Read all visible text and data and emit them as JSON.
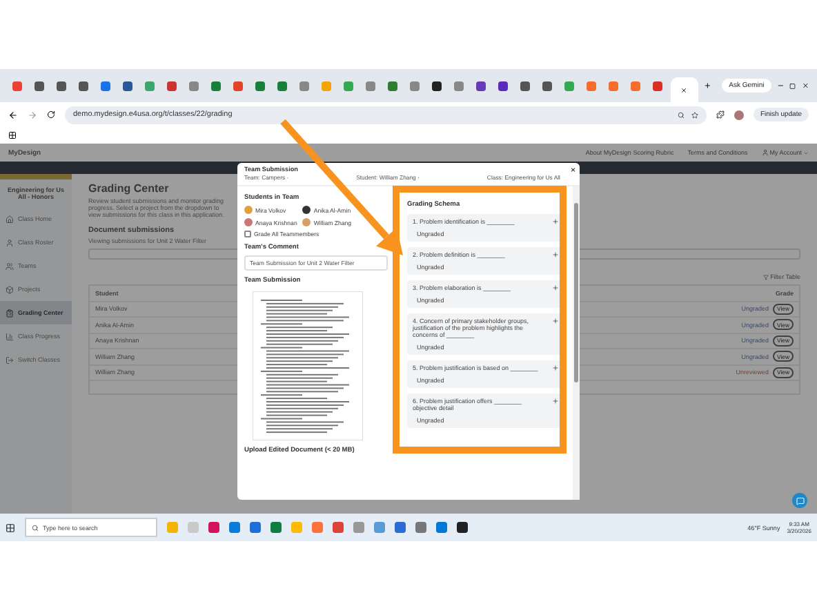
{
  "browser": {
    "ask_button": "Ask Gemini",
    "url": "demo.mydesign.e4usa.org/t/classes/22/grading",
    "update_button": "Finish update"
  },
  "header": {
    "logo": "MyDesign",
    "links": [
      "About MyDesign Scoring Rubric",
      "Terms and Conditions"
    ],
    "account": "My Account"
  },
  "sidebar": {
    "class_name": "Engineering for Us All - Honors",
    "items": [
      {
        "label": "Class Home",
        "selected": false
      },
      {
        "label": "Class Roster",
        "selected": false
      },
      {
        "label": "Teams",
        "selected": false
      },
      {
        "label": "Projects",
        "selected": false
      },
      {
        "label": "Grading Center",
        "selected": true
      },
      {
        "label": "Class Progress",
        "selected": false
      },
      {
        "label": "Switch Classes",
        "selected": false
      }
    ]
  },
  "main": {
    "title": "Grading Center",
    "description": "Review student submissions and monitor grading progress. Select a project from the dropdown to view submissions for this class in this application.",
    "section_title": "Document submissions",
    "section_subtitle": "Viewing submissions for Unit 2 Water Filter",
    "filter_button": "Filter Table",
    "table": {
      "columns": [
        "Student",
        "Grade"
      ],
      "rows": [
        {
          "student": "Mira Volkov",
          "grade": "Ungraded",
          "kind": "ungraded",
          "action": "View"
        },
        {
          "student": "Anika Al-Amin",
          "grade": "Ungraded",
          "kind": "ungraded",
          "action": "View"
        },
        {
          "student": "Anaya Krishnan",
          "grade": "Ungraded",
          "kind": "ungraded",
          "action": "View"
        },
        {
          "student": "William Zhang",
          "grade": "Ungraded",
          "kind": "ungraded",
          "action": "View"
        },
        {
          "student": "William Zhang",
          "grade": "Unreviewed",
          "kind": "unreviewed",
          "action": "View"
        }
      ]
    }
  },
  "modal": {
    "title": "Team Submission",
    "subtitle_parts": [
      "Team: Campers ·",
      "Student: William Zhang ·",
      "Class: Engineering for Us All"
    ],
    "close": "×",
    "students_title": "Students in Team",
    "students": [
      "Mira Volkov",
      "Anika Al-Amin",
      "Anaya Krishnan",
      "William Zhang"
    ],
    "grade_all": {
      "label": "Grade All Teammembers",
      "checked": false
    },
    "comment_title": "Team's Comment",
    "comment": "Team Submission for Unit 2 Water Filter",
    "submission_title": "Team Submission",
    "upload_label": "Upload Edited Document (< 20 MB)",
    "schema_title": "Grading Schema",
    "schema": [
      {
        "criterion": "1. Problem identification is ________",
        "status": "Ungraded"
      },
      {
        "criterion": "2. Problem definition is ________",
        "status": "Ungraded"
      },
      {
        "criterion": "3. Problem elaboration is ________",
        "status": "Ungraded"
      },
      {
        "criterion": "4. Concern of primary stakeholder groups, justification of the problem highlights the concerns of ________",
        "status": "Ungraded"
      },
      {
        "criterion": "5. Problem justification is based on ________",
        "status": "Ungraded"
      },
      {
        "criterion": "6. Problem justification offers ________ objective detail",
        "status": "Ungraded"
      }
    ]
  },
  "taskbar": {
    "search_placeholder": "Type here to search",
    "weather": "46°F  Sunny",
    "time": "9:33 AM",
    "date": "3/20/2026"
  }
}
